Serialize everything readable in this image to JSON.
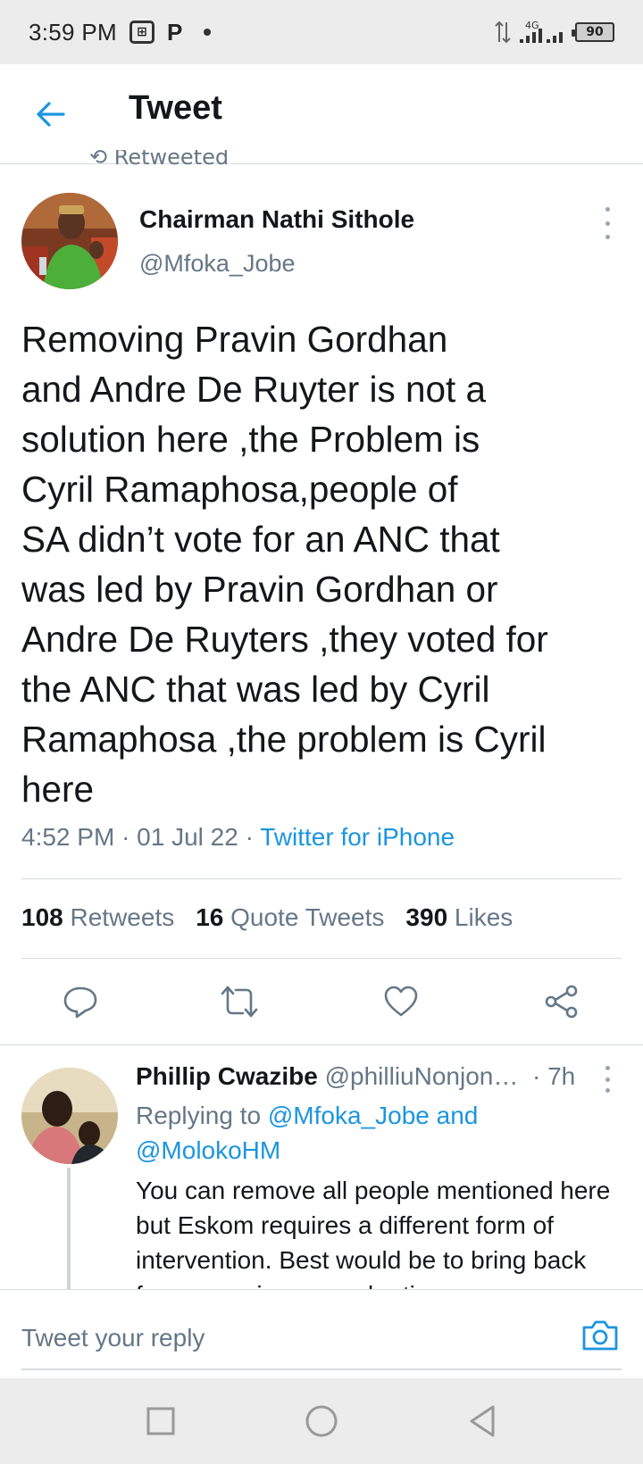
{
  "status_bar": {
    "time": "3:59 PM",
    "notification_icons": [
      "app-icon",
      "p-icon",
      "dot-icon"
    ],
    "network": "4G",
    "battery": "90"
  },
  "header": {
    "title": "Tweet"
  },
  "retweeted_label": "Retweeted",
  "tweet": {
    "author_name": "Chairman Nathi Sithole",
    "author_handle": "@Mfoka_Jobe",
    "text": "Removing Pravin Gordhan\nand Andre De Ruyter is not a\nsolution here ,the Problem is\nCyril Ramaphosa,people of\nSA didn’t vote for an ANC that\nwas led by Pravin Gordhan or\nAndre De Ruyters ,they voted for\nthe ANC that was led by Cyril\nRamaphosa ,the problem is Cyril\nhere",
    "time": "4:52 PM",
    "date": "01 Jul 22",
    "separator": "·",
    "source": "Twitter for iPhone",
    "stats": {
      "retweets_count": "108",
      "retweets_label": "Retweets",
      "quotes_count": "16",
      "quotes_label": "Quote Tweets",
      "likes_count": "390",
      "likes_label": "Likes"
    }
  },
  "reply": {
    "name": "Phillip Cwazibe",
    "handle": "@philliuNonjon…",
    "time": "· 7h",
    "replying_prefix": "Replying to",
    "mention_1": "@Mfoka_Jobe",
    "and_word": "and",
    "mention_2": "@MolokoHM",
    "text": "You can remove all people mentioned here but Eskom requires a different form of intervention. Best would be to bring back former engineers and retirees"
  },
  "composer": {
    "placeholder": "Tweet your reply"
  },
  "colors": {
    "accent": "#1b95e0",
    "secondary_text": "#657786",
    "divider": "#d6dbde"
  }
}
